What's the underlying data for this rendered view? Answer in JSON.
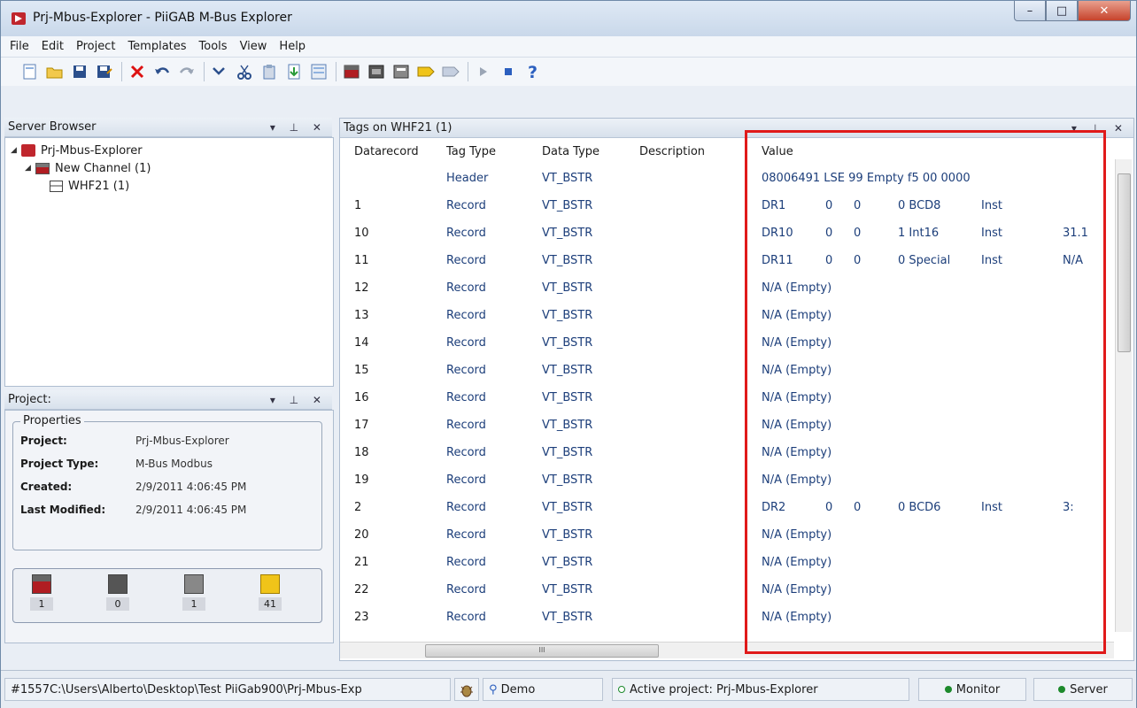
{
  "window": {
    "title": "Prj-Mbus-Explorer - PiiGAB M-Bus Explorer",
    "minimize": "–",
    "maximize": "□",
    "close": "✕"
  },
  "menu": [
    {
      "label": "File"
    },
    {
      "label": "Edit"
    },
    {
      "label": "Project"
    },
    {
      "label": "Templates"
    },
    {
      "label": "Tools"
    },
    {
      "label": "View"
    },
    {
      "label": "Help"
    }
  ],
  "server_browser": {
    "title": "Server Browser",
    "controls": "▾ ⊥ ✕",
    "project": "Prj-Mbus-Explorer",
    "channel": "New Channel (1)",
    "device": "WHF21 (1)"
  },
  "project_panel": {
    "title": "Project:",
    "controls": "▾ ⊥ ✕",
    "legend": "Properties",
    "rows": [
      {
        "label": "Project:",
        "value": "Prj-Mbus-Explorer"
      },
      {
        "label": "Project Type:",
        "value": "M-Bus Modbus"
      },
      {
        "label": "Created:",
        "value": "2/9/2011 4:06:45 PM"
      },
      {
        "label": "Last Modified:",
        "value": "2/9/2011 4:06:45 PM"
      }
    ],
    "counts": [
      {
        "icon": "channel-icon",
        "value": "1",
        "color": "#b01d22"
      },
      {
        "icon": "device-icon",
        "value": "0",
        "color": "#555555"
      },
      {
        "icon": "device-icon",
        "value": "1",
        "color": "#777777"
      },
      {
        "icon": "tag-icon",
        "value": "41",
        "color": "#e6b800"
      }
    ]
  },
  "tags": {
    "title": "Tags on WHF21 (1)",
    "controls": "▾ ⊥ ✕",
    "columns": {
      "datarecord": "Datarecord",
      "tag_type": "Tag Type",
      "data_type": "Data Type",
      "description": "Description",
      "value": "Value"
    },
    "rows": [
      {
        "record": "",
        "tag_type": "Header",
        "data_type": "VT_BSTR",
        "v1": "08006491 LSE 99 Empty f5 00 0000",
        "v2": "",
        "v3": "",
        "v4": "",
        "v5": "",
        "v6": ""
      },
      {
        "record": "1",
        "tag_type": "Record",
        "data_type": "VT_BSTR",
        "v1": "DR1",
        "v2": "0",
        "v3": "0",
        "v4": "0 BCD8",
        "v5": "Inst",
        "v6": ""
      },
      {
        "record": "10",
        "tag_type": "Record",
        "data_type": "VT_BSTR",
        "v1": "DR10",
        "v2": "0",
        "v3": "0",
        "v4": "1 Int16",
        "v5": "Inst",
        "v6": "31.1"
      },
      {
        "record": "11",
        "tag_type": "Record",
        "data_type": "VT_BSTR",
        "v1": "DR11",
        "v2": "0",
        "v3": "0",
        "v4": "0 Special",
        "v5": "Inst",
        "v6": "N/A"
      },
      {
        "record": "12",
        "tag_type": "Record",
        "data_type": "VT_BSTR",
        "v1": "N/A (Empty)",
        "v2": "",
        "v3": "",
        "v4": "",
        "v5": "",
        "v6": ""
      },
      {
        "record": "13",
        "tag_type": "Record",
        "data_type": "VT_BSTR",
        "v1": "N/A (Empty)",
        "v2": "",
        "v3": "",
        "v4": "",
        "v5": "",
        "v6": ""
      },
      {
        "record": "14",
        "tag_type": "Record",
        "data_type": "VT_BSTR",
        "v1": "N/A (Empty)",
        "v2": "",
        "v3": "",
        "v4": "",
        "v5": "",
        "v6": ""
      },
      {
        "record": "15",
        "tag_type": "Record",
        "data_type": "VT_BSTR",
        "v1": "N/A (Empty)",
        "v2": "",
        "v3": "",
        "v4": "",
        "v5": "",
        "v6": ""
      },
      {
        "record": "16",
        "tag_type": "Record",
        "data_type": "VT_BSTR",
        "v1": "N/A (Empty)",
        "v2": "",
        "v3": "",
        "v4": "",
        "v5": "",
        "v6": ""
      },
      {
        "record": "17",
        "tag_type": "Record",
        "data_type": "VT_BSTR",
        "v1": "N/A (Empty)",
        "v2": "",
        "v3": "",
        "v4": "",
        "v5": "",
        "v6": ""
      },
      {
        "record": "18",
        "tag_type": "Record",
        "data_type": "VT_BSTR",
        "v1": "N/A (Empty)",
        "v2": "",
        "v3": "",
        "v4": "",
        "v5": "",
        "v6": ""
      },
      {
        "record": "19",
        "tag_type": "Record",
        "data_type": "VT_BSTR",
        "v1": "N/A (Empty)",
        "v2": "",
        "v3": "",
        "v4": "",
        "v5": "",
        "v6": ""
      },
      {
        "record": "2",
        "tag_type": "Record",
        "data_type": "VT_BSTR",
        "v1": "DR2",
        "v2": "0",
        "v3": "0",
        "v4": "0 BCD6",
        "v5": "Inst",
        "v6": "3:"
      },
      {
        "record": "20",
        "tag_type": "Record",
        "data_type": "VT_BSTR",
        "v1": "N/A (Empty)",
        "v2": "",
        "v3": "",
        "v4": "",
        "v5": "",
        "v6": ""
      },
      {
        "record": "21",
        "tag_type": "Record",
        "data_type": "VT_BSTR",
        "v1": "N/A (Empty)",
        "v2": "",
        "v3": "",
        "v4": "",
        "v5": "",
        "v6": ""
      },
      {
        "record": "22",
        "tag_type": "Record",
        "data_type": "VT_BSTR",
        "v1": "N/A (Empty)",
        "v2": "",
        "v3": "",
        "v4": "",
        "v5": "",
        "v6": ""
      },
      {
        "record": "23",
        "tag_type": "Record",
        "data_type": "VT_BSTR",
        "v1": "N/A (Empty)",
        "v2": "",
        "v3": "",
        "v4": "",
        "v5": "",
        "v6": ""
      }
    ],
    "hscroll_grip": "III"
  },
  "status": {
    "path": "#1557C:\\Users\\Alberto\\Desktop\\Test PiiGab900\\Prj-Mbus-Exp",
    "demo": "Demo",
    "active_project": "Active project: Prj-Mbus-Explorer",
    "monitor": "Monitor",
    "server": "Server"
  },
  "colors": {
    "highlight": "#e01a1a",
    "link_text": "#1c3e7a",
    "status_ok": "#1d8a2c"
  }
}
